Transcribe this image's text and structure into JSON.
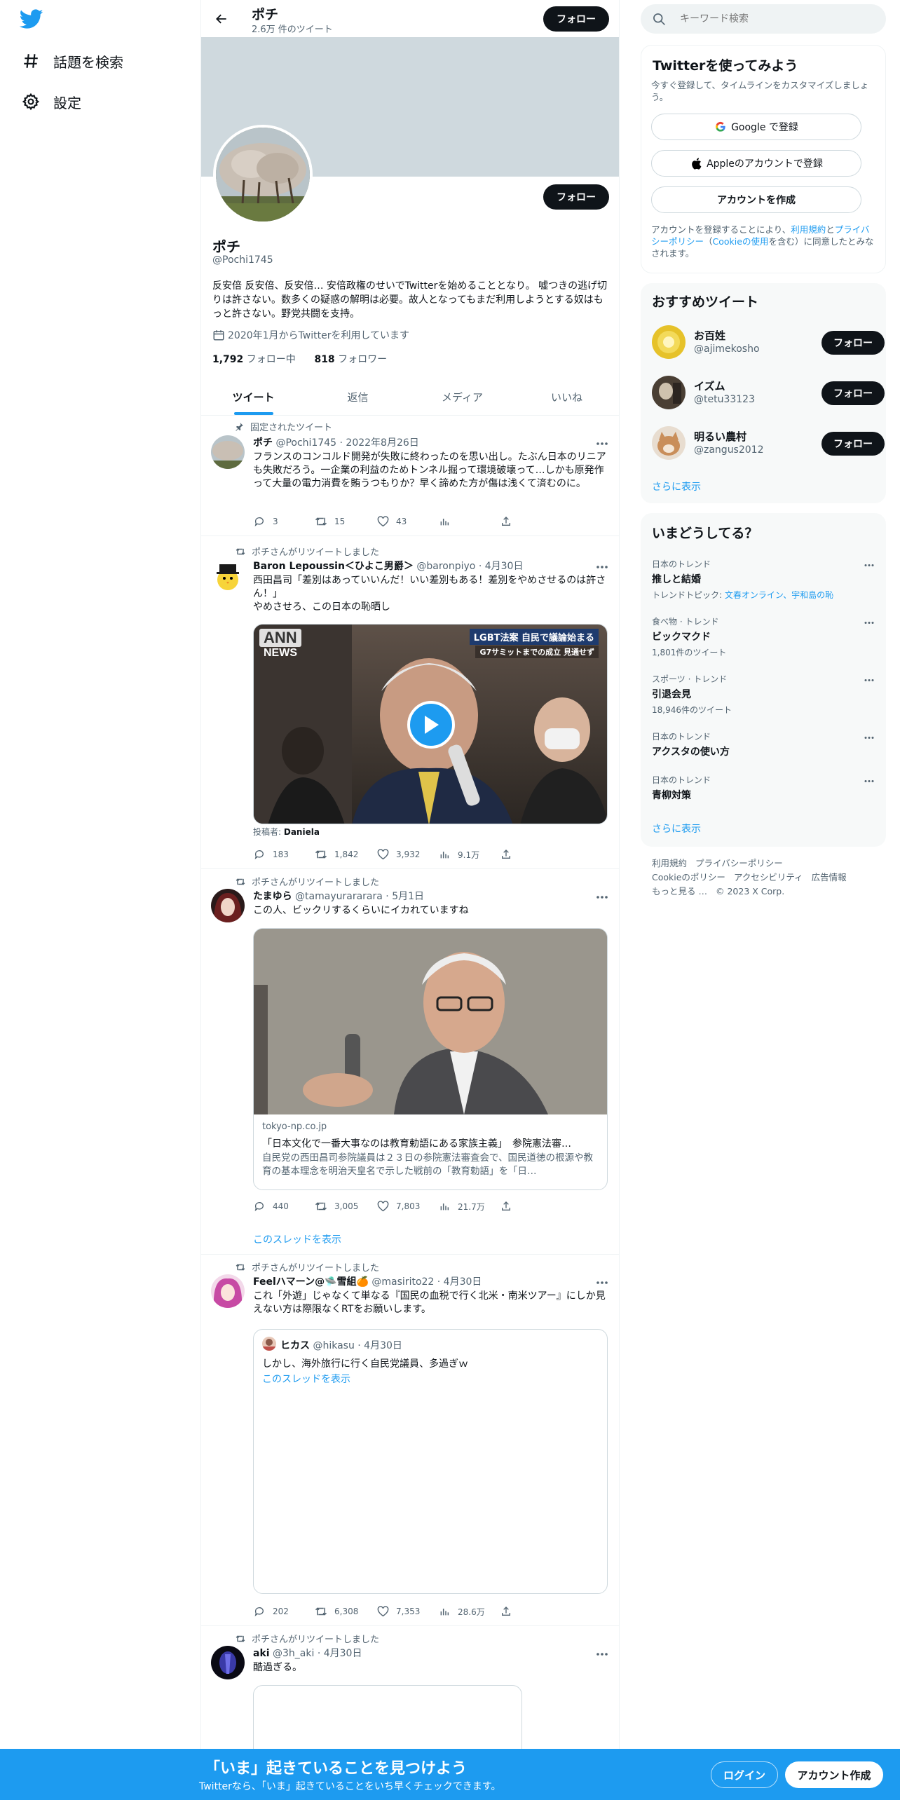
{
  "nav": {
    "explore_label": "話題を検索",
    "settings_label": "設定"
  },
  "profile": {
    "name": "ポチ",
    "tweet_count": "2.6万 件のツイート",
    "follow_label": "フォロー",
    "handle": "@Pochi1745",
    "bio": "反安倍 反安倍、反安倍… 安倍政権のせいでTwitterを始めることとなり。 嘘つきの逃げ切りは許さない。数多くの疑惑の解明は必要。故人となってもまだ利用しようとする奴はもっと許さない。野党共闘を支持。",
    "joined": "2020年1月からTwitterを利用しています",
    "following_count": "1,792",
    "following_label": "フォロー中",
    "followers_count": "818",
    "followers_label": "フォロワー"
  },
  "tabs": [
    "ツイート",
    "返信",
    "メディア",
    "いいね"
  ],
  "tweets": [
    {
      "meta": "固定されたツイート",
      "name": "ポチ",
      "handle": "@Pochi1745",
      "date": "· 2022年8月26日",
      "text": "フランスのコンコルド開発が失敗に終わったのを思い出し。たぶん日本のリニアも失敗だろう。一企業の利益のためトンネル掘って環境破壊って…しかも原発作って大量の電力消費を賄うつもりか？早く諦めた方が傷は浅くて済むのに。",
      "replies": "3",
      "retweets": "15",
      "likes": "43"
    },
    {
      "meta": "ポチさんがリツイートしました",
      "name": "Baron Lepoussin＜ひよこ男爵＞",
      "handle": "@baronpiyo",
      "date": "· 4月30日",
      "text": "西田昌司「差別はあっていいんだ！いい差別もある！差別をやめさせるのは許さん！」\nやめさせろ、この日本の恥晒し",
      "video_logo_top": "ANN",
      "video_logo_bottom": "NEWS",
      "video_caption1": "LGBT法案 自民で議論始まる",
      "video_caption2": "G7サミットまでの成立 見通せず",
      "poster_label": "投稿者:",
      "poster_name": "Daniela",
      "replies": "183",
      "retweets": "1,842",
      "likes": "3,932",
      "views": "9.1万"
    },
    {
      "meta": "ポチさんがリツイートしました",
      "name": "たまゆら",
      "handle": "@tamayurararara",
      "date": "· 5月1日",
      "text": "この人、ビックリするくらいにイカれていますね",
      "card_domain": "tokyo-np.co.jp",
      "card_title": "「日本文化で一番大事なのは教育勅語にある家族主義」　参院憲法審…",
      "card_desc": "自民党の西田昌司参院議員は２３日の参院憲法審査会で、国民道徳の根源や教育の基本理念を明治天皇名で示した戦前の「教育勅語」を「日…",
      "replies": "440",
      "retweets": "3,005",
      "likes": "7,803",
      "views": "21.7万",
      "show_thread": "このスレッドを表示"
    },
    {
      "meta": "ポチさんがリツイートしました",
      "name": "Feelハマーン@🛸雪組🍊",
      "handle": "@masirito22",
      "date": "· 4月30日",
      "text": "これ「外遊」じゃなくて単なる『国民の血税で行く北米・南米ツアー』にしか見えない方は際限なくRTをお願いします。",
      "quote_name": "ヒカス",
      "quote_handle": "@hikasu",
      "quote_date": "· 4月30日",
      "quote_text": "しかし、海外旅行に行く自民党議員、多過ぎｗ",
      "quote_thread": "このスレッドを表示",
      "replies": "202",
      "retweets": "6,308",
      "likes": "7,353",
      "views": "28.6万"
    },
    {
      "meta": "ポチさんがリツイートしました",
      "name": "aki",
      "handle": "@3h_aki",
      "date": "· 4月30日",
      "text": "酷過ぎる。"
    }
  ],
  "right": {
    "search_placeholder": "キーワード検索",
    "signup_title": "Twitterを使ってみよう",
    "signup_desc": "今すぐ登録して、タイムラインをカスタマイズしましょう。",
    "google_btn": "Google で登録",
    "apple_btn": "Appleのアカウントで登録",
    "create_btn": "アカウントを作成",
    "terms_pre": "アカウントを登録することにより、",
    "terms_link1": "利用規約",
    "terms_and": "と",
    "terms_link2": "プライバシーポリシー",
    "terms_paren_open": "（",
    "terms_link3": "Cookieの使用",
    "terms_post": "を含む）に同意したとみなされます。",
    "recommend_title": "おすすめツイート",
    "recommend": [
      {
        "name": "お百姓",
        "handle": "@ajimekosho"
      },
      {
        "name": "イズム",
        "handle": "@tetu33123"
      },
      {
        "name": "明るい農村",
        "handle": "@zangus2012"
      }
    ],
    "follow_label": "フォロー",
    "show_more": "さらに表示",
    "trends_title": "いまどうしてる？",
    "trends": [
      {
        "category": "日本のトレンド",
        "title": "推しと結婚",
        "sub_prefix": "トレンドトピック: ",
        "sub_link": "文春オンライン、宇和島の恥"
      },
      {
        "category": "食べ物 · トレンド",
        "title": "ビックマクド",
        "sub": "1,801件のツイート"
      },
      {
        "category": "スポーツ · トレンド",
        "title": "引退会見",
        "sub": "18,946件のツイート"
      },
      {
        "category": "日本のトレンド",
        "title": "アクスタの使い方"
      },
      {
        "category": "日本のトレンド",
        "title": "青柳対策"
      }
    ],
    "footer": [
      "利用規約",
      "プライバシーポリシー",
      "Cookieのポリシー",
      "アクセシビリティ",
      "広告情報",
      "もっと見る …",
      "© 2023 X Corp."
    ]
  },
  "bottom_bar": {
    "title": "「いま」起きていることを見つけよう",
    "subtitle": "Twitterなら、「いま」起きていることをいち早くチェックできます。",
    "login": "ログイン",
    "signup": "アカウント作成"
  },
  "colors": {
    "accent": "#1d9bf0",
    "text": "#0f1419",
    "secondary": "#536471",
    "banner": "#cfd9de"
  }
}
